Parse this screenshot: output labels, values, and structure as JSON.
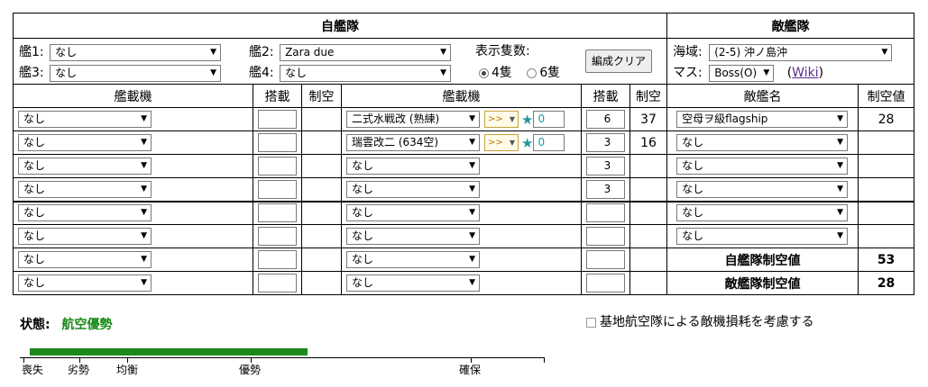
{
  "header": {
    "own_fleet": "自艦隊",
    "enemy_fleet": "敵艦隊"
  },
  "own_config": {
    "ships": [
      {
        "label": "艦1:",
        "value": "なし"
      },
      {
        "label": "艦2:",
        "value": "Zara due"
      },
      {
        "label": "艦3:",
        "value": "なし"
      },
      {
        "label": "艦4:",
        "value": "なし"
      }
    ],
    "display_count_label": "表示隻数:",
    "option_4": "4隻",
    "option_6": "6隻",
    "selected": "4隻",
    "clear_button": "編成クリア"
  },
  "enemy_config": {
    "area_label": "海域:",
    "area_value": "(2-5) 沖ノ島沖",
    "node_label": "マス:",
    "node_value": "Boss(O)",
    "wiki_open": "(",
    "wiki_link": "Wiki",
    "wiki_close": ")"
  },
  "columns": {
    "equipment": "艦載機",
    "slots": "搭載",
    "air_control": "制空",
    "enemy_name": "敵艦名",
    "enemy_air_value": "制空値"
  },
  "left_rows": [
    {
      "equip": "なし",
      "slots": "",
      "air": ""
    },
    {
      "equip": "なし",
      "slots": "",
      "air": ""
    },
    {
      "equip": "なし",
      "slots": "",
      "air": ""
    },
    {
      "equip": "なし",
      "slots": "",
      "air": ""
    },
    {
      "equip": "なし",
      "slots": "",
      "air": ""
    },
    {
      "equip": "なし",
      "slots": "",
      "air": ""
    },
    {
      "equip": "なし",
      "slots": "",
      "air": ""
    },
    {
      "equip": "なし",
      "slots": "",
      "air": ""
    }
  ],
  "mid_rows": [
    {
      "equip": "二式水戦改 (熟練)",
      "prof": ">>",
      "improve": "0",
      "slots": "6",
      "air": "37"
    },
    {
      "equip": "瑞雲改二 (634空)",
      "prof": ">>",
      "improve": "0",
      "slots": "3",
      "air": "16"
    },
    {
      "equip": "なし",
      "slots": "3",
      "air": ""
    },
    {
      "equip": "なし",
      "slots": "3",
      "air": ""
    },
    {
      "equip": "なし",
      "slots": "",
      "air": ""
    },
    {
      "equip": "なし",
      "slots": "",
      "air": ""
    },
    {
      "equip": "なし",
      "slots": "",
      "air": ""
    },
    {
      "equip": "なし",
      "slots": "",
      "air": ""
    }
  ],
  "enemy_rows": [
    {
      "name": "空母ヲ級flagship",
      "air": "28"
    },
    {
      "name": "なし",
      "air": ""
    },
    {
      "name": "なし",
      "air": ""
    },
    {
      "name": "なし",
      "air": ""
    },
    {
      "name": "なし",
      "air": ""
    },
    {
      "name": "なし",
      "air": ""
    }
  ],
  "totals": {
    "own_label": "自艦隊制空値",
    "own_value": "53",
    "enemy_label": "敵艦隊制空値",
    "enemy_value": "28"
  },
  "status": {
    "label": "状態:",
    "value": "航空優勢",
    "color": "#1a8a1a"
  },
  "base_air_checkbox": "基地航空隊による敵機損耗を考慮する",
  "gauge": {
    "fill_fraction": 0.53,
    "fill_color": "#1a8a1a",
    "ticks": [
      "喪失",
      "劣勢",
      "均衡",
      "優勢",
      "確保"
    ]
  }
}
